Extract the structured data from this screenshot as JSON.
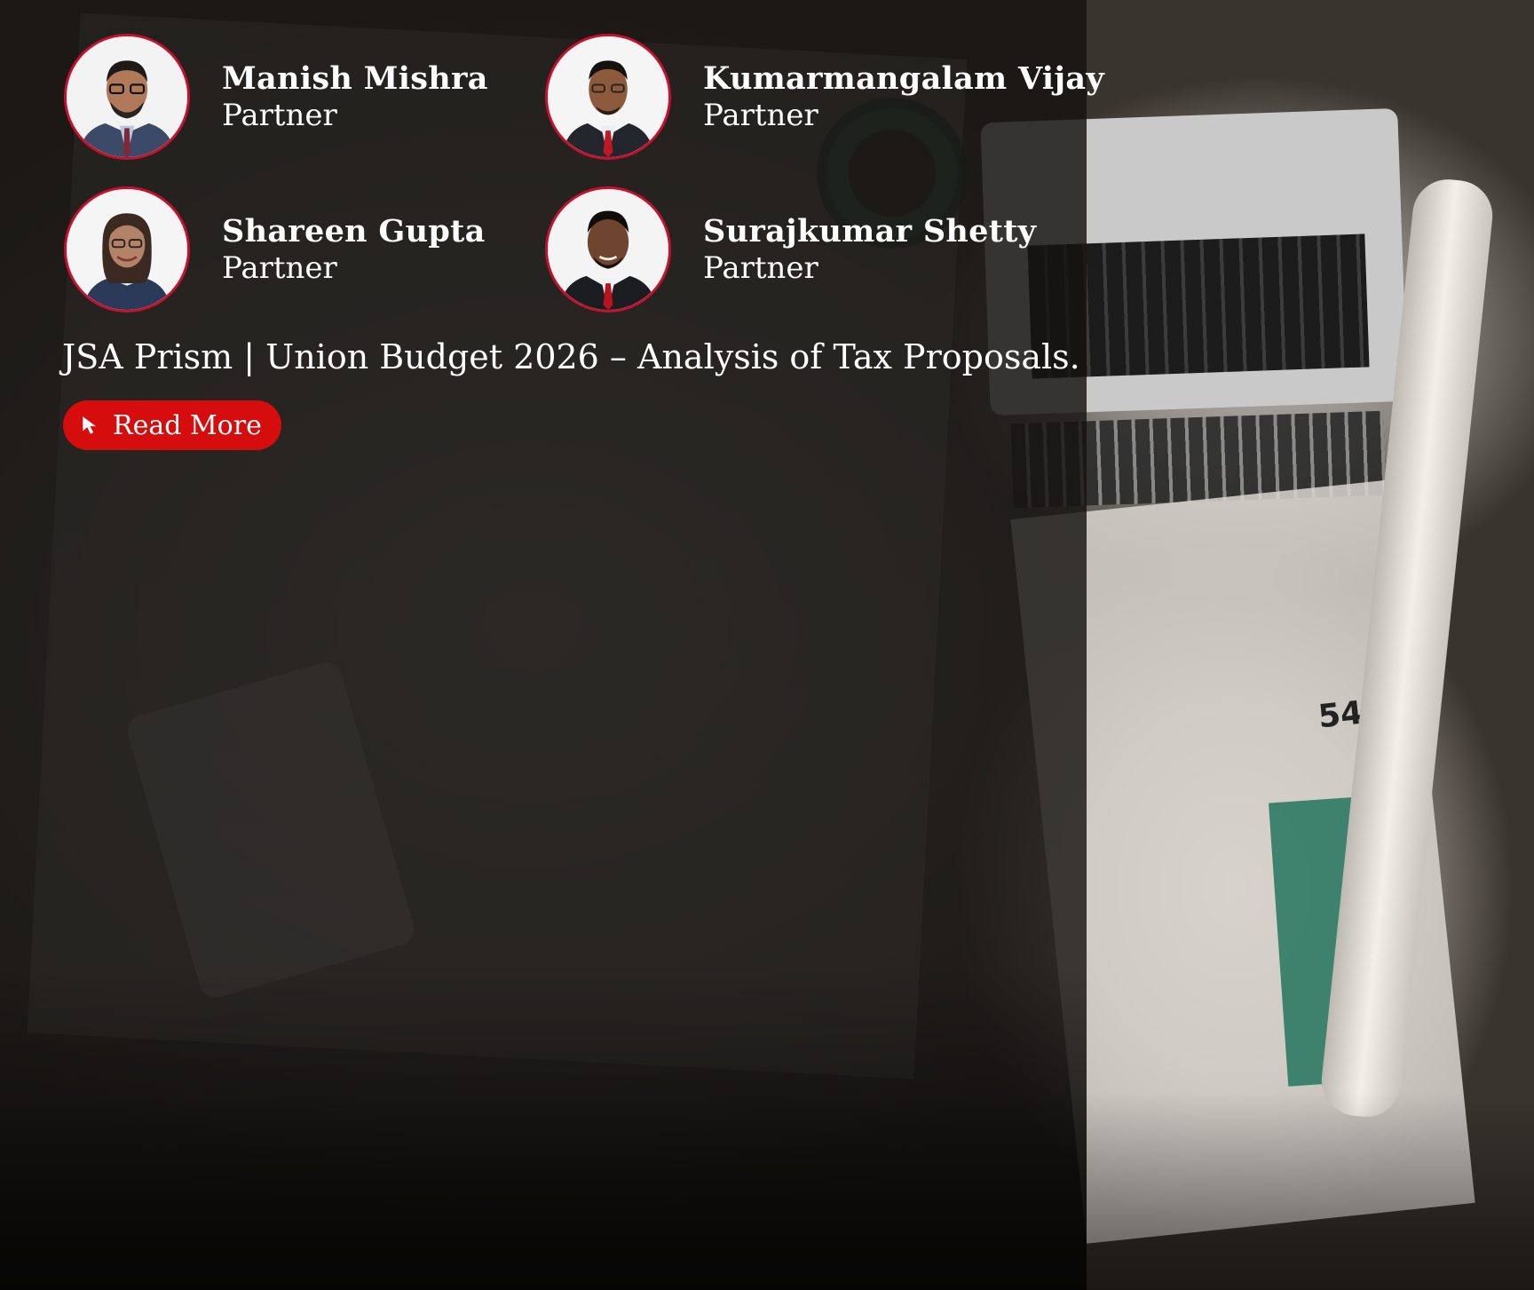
{
  "authors": [
    {
      "name": "Manish Mishra",
      "role": "Partner",
      "avatar_icon": "person-portrait-icon"
    },
    {
      "name": "Kumarmangalam Vijay",
      "role": "Partner",
      "avatar_icon": "person-portrait-icon"
    },
    {
      "name": "Shareen Gupta",
      "role": "Partner",
      "avatar_icon": "person-portrait-icon"
    },
    {
      "name": "Surajkumar Shetty",
      "role": "Partner",
      "avatar_icon": "person-portrait-icon"
    }
  ],
  "article": {
    "title": "JSA Prism | Union Budget 2026 – Analysis of Tax Proposals."
  },
  "read_more": {
    "label": "Read More",
    "icon": "cursor-arrow-icon"
  },
  "colors": {
    "accent": "#d60d0d",
    "avatar_border": "#c8102e",
    "text": "#ffffff",
    "overlay": "#141210"
  },
  "background": {
    "magazine_page_number": "54"
  }
}
